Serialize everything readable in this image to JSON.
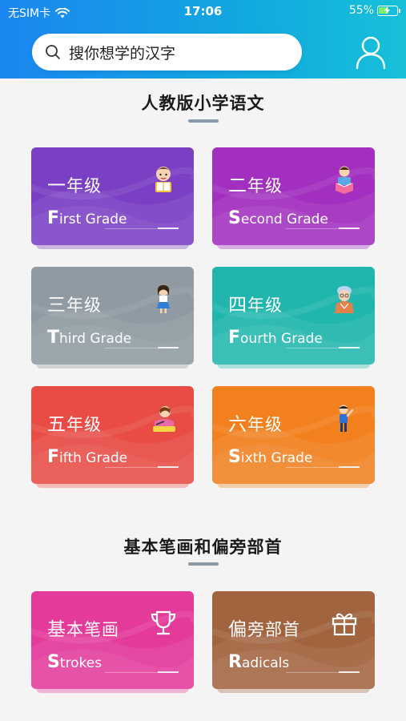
{
  "status_bar": {
    "carrier": "无SIM卡",
    "time": "17:06",
    "battery": "55%",
    "battery_level": 0.55
  },
  "search": {
    "placeholder": "搜你想学的汉字",
    "icon": "search-icon"
  },
  "profile": {
    "icon": "user-icon"
  },
  "sections": [
    {
      "title": "人教版小学语文",
      "cards": [
        {
          "cn_first": "一",
          "cn_rest": "年级",
          "en_initial": "F",
          "en_rest": "irst Grade",
          "color": "#7a3fc4",
          "icon": "child-reading-icon"
        },
        {
          "cn_first": "二",
          "cn_rest": "年级",
          "en_initial": "S",
          "en_rest": "econd Grade",
          "color": "#a22fbf",
          "icon": "child-book-icon"
        },
        {
          "cn_first": "三",
          "cn_rest": "年级",
          "en_initial": "T",
          "en_rest": "hird Grade",
          "color": "#8f9aa2",
          "icon": "girl-icon"
        },
        {
          "cn_first": "四",
          "cn_rest": "年级",
          "en_initial": "F",
          "en_rest": "ourth Grade",
          "color": "#20b6ad",
          "icon": "grandma-icon"
        },
        {
          "cn_first": "五",
          "cn_rest": "年级",
          "en_initial": "F",
          "en_rest": "ifth Grade",
          "color": "#e84c45",
          "icon": "child-writing-icon"
        },
        {
          "cn_first": "六",
          "cn_rest": "年级",
          "en_initial": "S",
          "en_rest": "ixth Grade",
          "color": "#f2801f",
          "icon": "boy-pointing-icon"
        }
      ]
    },
    {
      "title": "基本笔画和偏旁部首",
      "cards": [
        {
          "cn_first": "基",
          "cn_rest": "本笔画",
          "en_initial": "S",
          "en_rest": "trokes",
          "color": "#e43b9b",
          "icon": "trophy-icon"
        },
        {
          "cn_first": "偏",
          "cn_rest": "旁部首",
          "en_initial": "R",
          "en_rest": "adicals",
          "color": "#a2643f",
          "icon": "gift-icon"
        }
      ]
    }
  ]
}
